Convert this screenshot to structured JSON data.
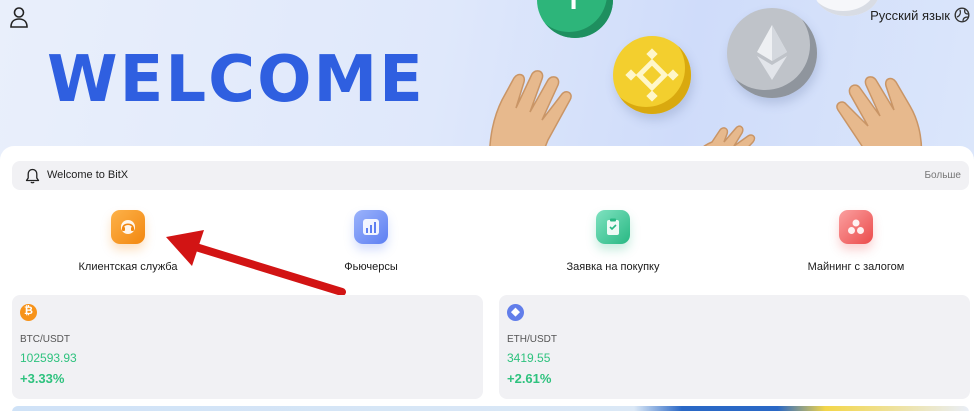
{
  "header": {
    "banner_title": "WELCOME",
    "language_label": "Русский язык"
  },
  "notice": {
    "text": "Welcome to BitX",
    "more_label": "Больше"
  },
  "menu": [
    {
      "label": "Клиентская служба",
      "icon": "headset-icon",
      "color": "#f2870f"
    },
    {
      "label": "Фьючерсы",
      "icon": "chart-up-icon",
      "color": "#5d7ff2"
    },
    {
      "label": "Заявка на покупку",
      "icon": "clipboard-icon",
      "color": "#28b883"
    },
    {
      "label": "Майнинг с залогом",
      "icon": "mining-icon",
      "color": "#eb4b4b"
    }
  ],
  "tickers": [
    {
      "symbol": "BTC/USDT",
      "price": "102593.93",
      "change": "+3.33%",
      "icon": "bitcoin-icon",
      "icon_glyph": "₿",
      "color": "#f7931a"
    },
    {
      "symbol": "ETH/USDT",
      "price": "3419.55",
      "change": "+2.61%",
      "icon": "ethereum-icon",
      "icon_glyph": "◆",
      "color": "#627eea"
    }
  ],
  "colors": {
    "accent_blue": "#2f5fe0",
    "positive_green": "#2ec27e",
    "annotation_arrow": "#d21414"
  }
}
